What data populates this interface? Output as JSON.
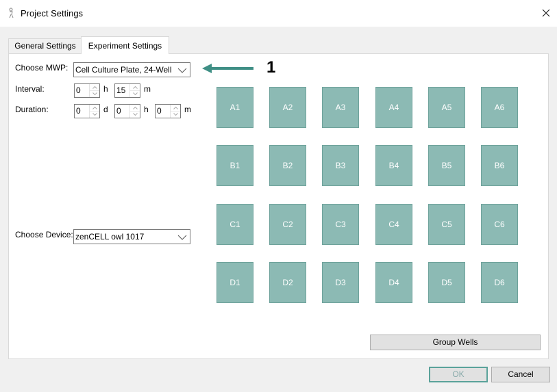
{
  "window": {
    "title": "Project Settings"
  },
  "tabs": [
    {
      "label": "General Settings"
    },
    {
      "label": "Experiment Settings"
    }
  ],
  "experiment": {
    "mwp_label": "Choose MWP:",
    "mwp_value": "Cell Culture Plate, 24-Well",
    "interval_label": "Interval:",
    "interval_h": "0",
    "interval_h_unit": "h",
    "interval_m": "15",
    "interval_m_unit": "m",
    "duration_label": "Duration:",
    "duration_d": "0",
    "duration_d_unit": "d",
    "duration_h": "0",
    "duration_h_unit": "h",
    "duration_m": "0",
    "duration_m_unit": "m",
    "device_label": "Choose Device:",
    "device_value": "zenCELL owl 1017"
  },
  "wells": [
    [
      "A1",
      "A2",
      "A3",
      "A4",
      "A5",
      "A6"
    ],
    [
      "B1",
      "B2",
      "B3",
      "B4",
      "B5",
      "B6"
    ],
    [
      "C1",
      "C2",
      "C3",
      "C4",
      "C5",
      "C6"
    ],
    [
      "D1",
      "D2",
      "D3",
      "D4",
      "D5",
      "D6"
    ]
  ],
  "buttons": {
    "group_wells": "Group Wells",
    "ok": "OK",
    "cancel": "Cancel"
  },
  "annotation": {
    "number": "1",
    "arrow_color": "#3f8f85"
  },
  "colors": {
    "well_fill": "#8cbab4",
    "well_border": "#6ea29b",
    "accent": "#5aa29a"
  }
}
